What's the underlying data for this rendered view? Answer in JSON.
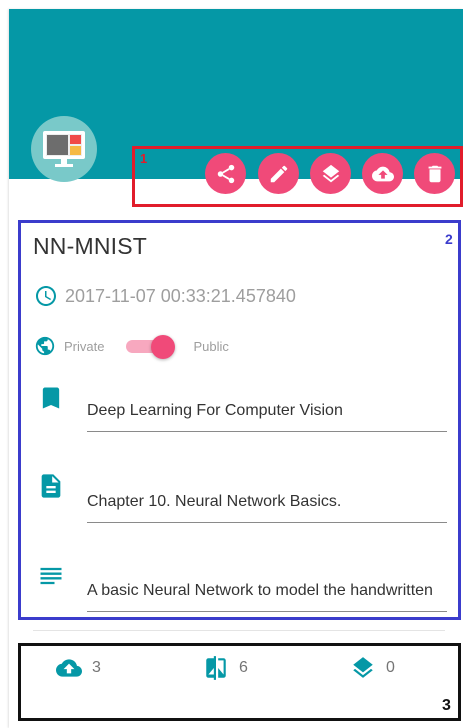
{
  "project": {
    "title": "NN-MNIST",
    "timestamp": "2017-11-07 00:33:21.457840",
    "visibility": {
      "private_label": "Private",
      "public_label": "Public",
      "is_public": true
    }
  },
  "fields": [
    {
      "icon": "bookmark-icon",
      "value": "Deep Learning For Computer Vision"
    },
    {
      "icon": "document-icon",
      "value": "Chapter 10. Neural Network Basics."
    },
    {
      "icon": "notes-icon",
      "value": "A basic Neural Network to model the handwritten"
    }
  ],
  "actions": [
    "share-icon",
    "edit-icon",
    "layers-icon",
    "upload-icon",
    "delete-icon"
  ],
  "stats": {
    "uploads": "3",
    "forks": "6",
    "layers": "0"
  },
  "annotations": {
    "box1": "1",
    "box2": "2",
    "box3": "3"
  },
  "colors": {
    "header": "#0598a6",
    "accent": "#f04a79",
    "icon": "#0598a6",
    "box1": "#e11d2b",
    "box2": "#3b3ccc",
    "box3": "#111111"
  }
}
